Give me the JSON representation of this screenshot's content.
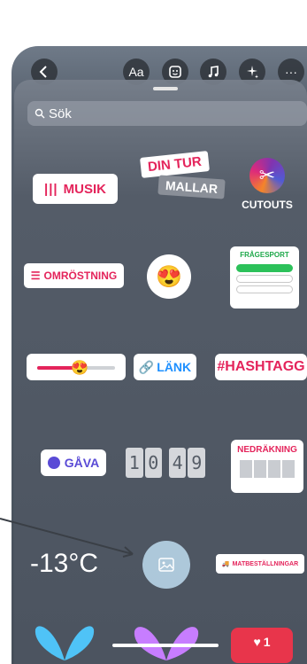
{
  "toolbar": {
    "text_label": "Aa",
    "more_label": "···",
    "icons": [
      "back-icon",
      "text-icon",
      "sticker-icon",
      "music-icon",
      "effects-icon",
      "more-icon"
    ]
  },
  "search": {
    "placeholder": "Sök"
  },
  "stickers": {
    "musik": "MUSIK",
    "din_tur": "DIN TUR",
    "mallar": "MALLAR",
    "cutouts": "CUTOUTS",
    "omrostning": "OMRÖSTNING",
    "fragesport": "FRÅGESPORT",
    "lank": "LÄNK",
    "hashtagg": "#HASHTAGG",
    "gava": "GÅVA",
    "clock_digits": [
      "1",
      "0",
      "4",
      "9"
    ],
    "nedrakning": "NEDRÄKNING",
    "temperature": "-13°C",
    "matbestallningar": "MATBESTÄLLNINGAR",
    "like_count": "1"
  },
  "colors": {
    "accent": "#e4245b",
    "link": "#1e90ff",
    "gift": "#5a4bd6",
    "quiz": "#1ea84a"
  }
}
